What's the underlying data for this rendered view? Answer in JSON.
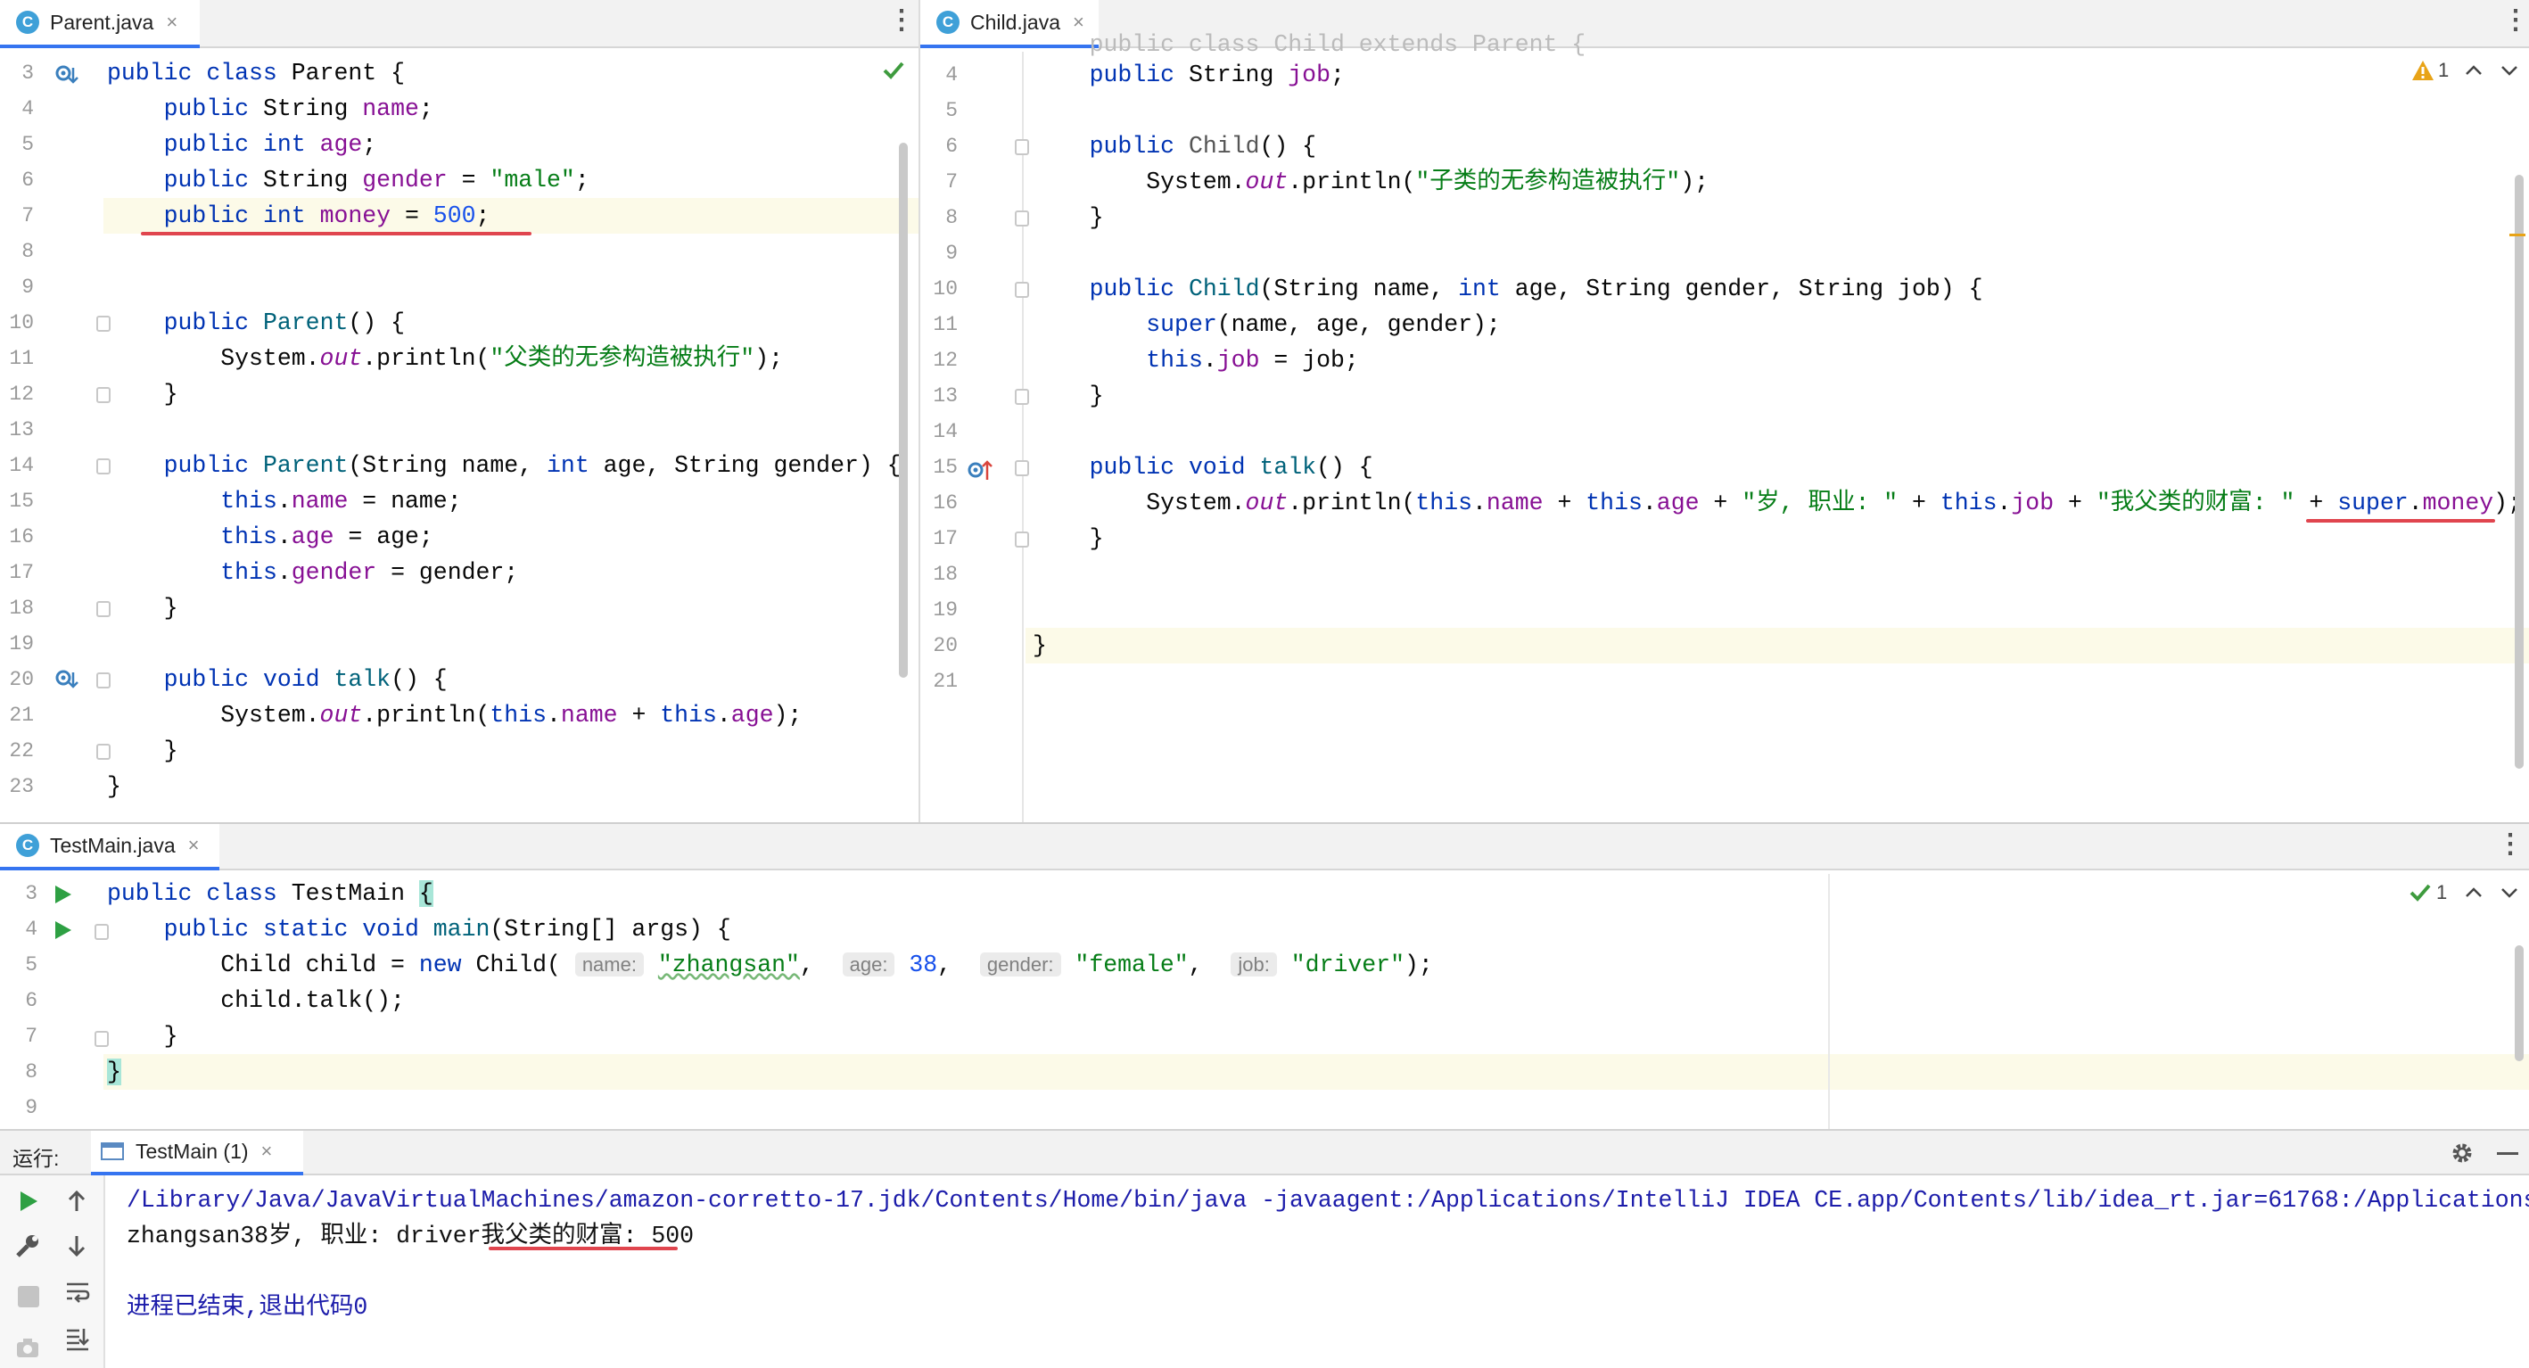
{
  "editors": {
    "parent": {
      "tab": {
        "icon": "C",
        "name": "Parent.java",
        "close": "×"
      },
      "line_numbers": [
        "3",
        "4",
        "5",
        "6",
        "7",
        "8",
        "9",
        "10",
        "11",
        "12",
        "13",
        "14",
        "15",
        "16",
        "17",
        "18",
        "19",
        "20",
        "21",
        "22",
        "23"
      ]
    },
    "child": {
      "tab": {
        "icon": "C",
        "name": "Child.java",
        "close": "×"
      },
      "line_numbers": [
        "4",
        "5",
        "6",
        "7",
        "8",
        "9",
        "10",
        "11",
        "12",
        "13",
        "14",
        "15",
        "16",
        "17",
        "18",
        "19",
        "20",
        "21"
      ],
      "warning_count": "1"
    },
    "testmain": {
      "tab": {
        "icon": "C",
        "name": "TestMain.java",
        "close": "×"
      },
      "line_numbers": [
        "3",
        "4",
        "5",
        "6",
        "7",
        "8",
        "9"
      ],
      "check_count": "1"
    }
  },
  "run": {
    "label": "运行:",
    "tab_name": "TestMain (1)",
    "tab_close": "×",
    "output": [
      "/Library/Java/JavaVirtualMachines/amazon-corretto-17.jdk/Contents/Home/bin/java -javaagent:/Applications/IntelliJ IDEA CE.app/Contents/lib/idea_rt.jar=61768:/Applications",
      "zhangsan38岁, 职业: driver我父类的财富: 500",
      "",
      "进程已结束,退出代码0"
    ]
  },
  "colors": {
    "keyword": "#0033b3",
    "string": "#067d17",
    "field": "#871094",
    "number": "#1750eb",
    "method": "#00627a",
    "annotation_underline": "#e0454e",
    "tab_accent": "#3574f0",
    "run_green": "#2ea043",
    "console_blue": "#1c1caa"
  },
  "icons": [
    "class-c-icon",
    "close-icon",
    "more-vertical-icon",
    "override-icon",
    "overridden-icon",
    "fold-icon",
    "check-icon",
    "warning-icon",
    "chevron-up-icon",
    "chevron-down-icon",
    "run-icon",
    "rerun-icon",
    "wrench-icon",
    "stop-icon",
    "soft-wrap-icon",
    "scroll-end-icon",
    "camera-icon",
    "gear-icon",
    "minimize-icon",
    "arrow-up-icon",
    "arrow-down-icon"
  ]
}
